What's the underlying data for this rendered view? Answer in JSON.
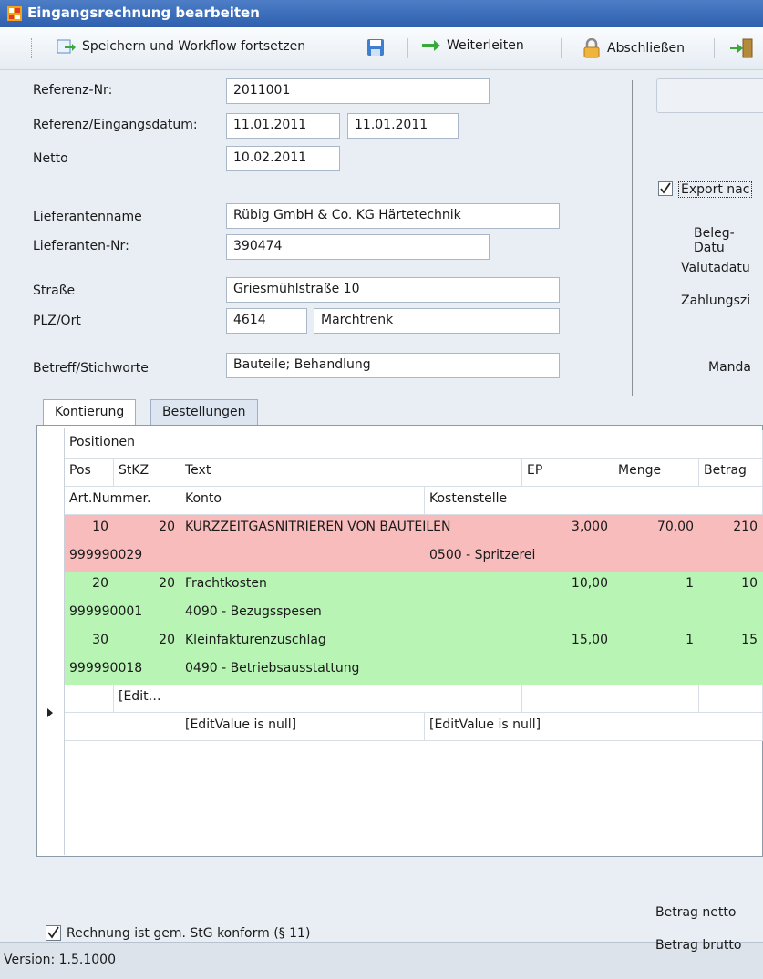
{
  "window": {
    "title": "Eingangsrechnung bearbeiten"
  },
  "toolbar": {
    "save_continue": "Speichern und Workflow fortsetzen",
    "forward": "Weiterleiten",
    "close": "Abschließen"
  },
  "form": {
    "referenz_nr_label": "Referenz-Nr:",
    "referenz_nr": "2011001",
    "datum_label": "Referenz/Eingangsdatum:",
    "referenz_datum": "11.01.2011",
    "eingangs_datum": "11.01.2011",
    "netto_label": "Netto",
    "netto_datum": "10.02.2011",
    "lieferantenname_label": "Lieferantenname",
    "lieferantenname": "Rübig GmbH & Co. KG Härtetechnik",
    "lieferanten_nr_label": "Lieferanten-Nr:",
    "lieferanten_nr": "390474",
    "strasse_label": "Straße",
    "strasse": "Griesmühlstraße 10",
    "plz_ort_label": "PLZ/Ort",
    "plz": "4614",
    "ort": "Marchtrenk",
    "betreff_label": "Betreff/Stichworte",
    "betreff": "Bauteile; Behandlung"
  },
  "right_panel": {
    "export_label": "Export nac",
    "beleg_datum": "Beleg-Datu",
    "valutadatum": "Valutadatu",
    "zahlungsziel": "Zahlungszi",
    "mandant": "Manda"
  },
  "tabs": [
    {
      "label": "Kontierung"
    },
    {
      "label": "Bestellungen"
    }
  ],
  "grid": {
    "band": "Positionen",
    "headers1": {
      "pos": "Pos",
      "stkz": "StKZ",
      "text": "Text",
      "ep": "EP",
      "menge": "Menge",
      "betrag": "Betrag"
    },
    "headers2": {
      "art": "Art.Nummer.",
      "konto": "Konto",
      "kostenstelle": "Kostenstelle"
    },
    "rows": [
      {
        "pos": "10",
        "stkz": "20",
        "text": "KURZZEITGASNITRIEREN VON BAUTEILEN",
        "ep": "3,000",
        "menge": "70,00",
        "betrag": "210",
        "art": "999990029",
        "konto": "",
        "kostenstelle": "0500 - Spritzerei"
      },
      {
        "pos": "20",
        "stkz": "20",
        "text": "Frachtkosten",
        "ep": "10,00",
        "menge": "1",
        "betrag": "10",
        "art": "999990001",
        "konto": "4090 - Bezugsspesen",
        "kostenstelle": ""
      },
      {
        "pos": "30",
        "stkz": "20",
        "text": "Kleinfakturenzuschlag",
        "ep": "15,00",
        "menge": "1",
        "betrag": "15",
        "art": "999990018",
        "konto": "0490 - Betriebsausstattung",
        "kostenstelle": ""
      }
    ],
    "new_row": {
      "stkz": "[Edit…",
      "konto": "[EditValue is null]",
      "kostenstelle": "[EditValue is null]"
    }
  },
  "footer": {
    "stg_label": "Rechnung ist gem. StG konform (§ 11)",
    "betrag_netto": "Betrag netto",
    "betrag_brutto": "Betrag brutto"
  },
  "status": {
    "version": "Version: 1.5.1000"
  },
  "colors": {
    "row_pink": "#f9bcbc",
    "row_green": "#b8f4b4",
    "title_blue": "#2f5fae"
  }
}
